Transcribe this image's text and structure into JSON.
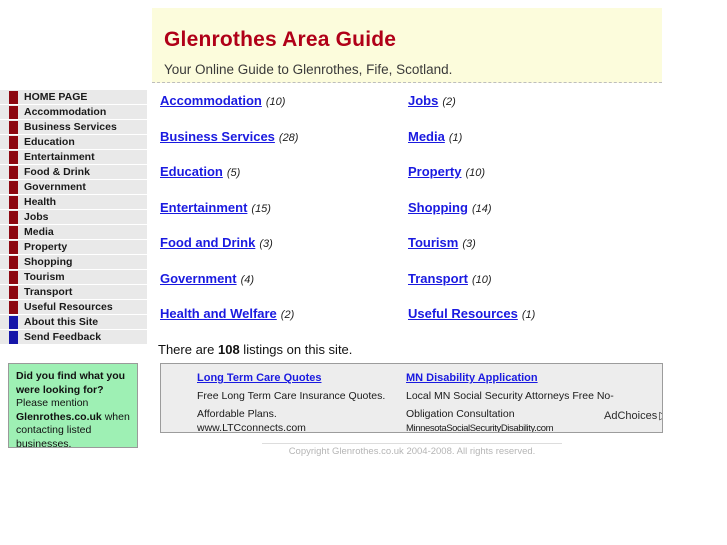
{
  "banner": {
    "title": "Glenrothes Area Guide",
    "tagline": "Your Online Guide to Glenrothes, Fife, Scotland."
  },
  "sidebar": {
    "items": [
      {
        "label": "HOME PAGE",
        "bullet_color": "#8c0711"
      },
      {
        "label": "Accommodation",
        "bullet_color": "#8c0711"
      },
      {
        "label": "Business Services",
        "bullet_color": "#8c0711"
      },
      {
        "label": "Education",
        "bullet_color": "#8c0711"
      },
      {
        "label": "Entertainment",
        "bullet_color": "#8c0711"
      },
      {
        "label": "Food & Drink",
        "bullet_color": "#8c0711"
      },
      {
        "label": "Government",
        "bullet_color": "#8c0711"
      },
      {
        "label": "Health",
        "bullet_color": "#8c0711"
      },
      {
        "label": "Jobs",
        "bullet_color": "#8c0711"
      },
      {
        "label": "Media",
        "bullet_color": "#8c0711"
      },
      {
        "label": "Property",
        "bullet_color": "#8c0711"
      },
      {
        "label": "Shopping",
        "bullet_color": "#8c0711"
      },
      {
        "label": "Tourism",
        "bullet_color": "#8c0711"
      },
      {
        "label": "Transport",
        "bullet_color": "#8c0711"
      },
      {
        "label": "Useful Resources",
        "bullet_color": "#8c0711"
      },
      {
        "label": "About this Site",
        "bullet_color": "#1515a8"
      },
      {
        "label": "Send Feedback",
        "bullet_color": "#1515a8"
      }
    ]
  },
  "promo": {
    "heading": "Did you find what you were looking for?",
    "text_before": "Please mention ",
    "brand": "Glenrothes.co.uk",
    "text_after": " when contacting listed businesses."
  },
  "categories": {
    "left": [
      {
        "label": "Accommodation",
        "count": "(10)"
      },
      {
        "label": "Business Services",
        "count": "(28)"
      },
      {
        "label": "Education",
        "count": "(5)"
      },
      {
        "label": "Entertainment",
        "count": "(15)"
      },
      {
        "label": "Food and Drink",
        "count": "(3)"
      },
      {
        "label": "Government",
        "count": "(4)"
      },
      {
        "label": "Health and Welfare",
        "count": "(2)"
      }
    ],
    "right": [
      {
        "label": "Jobs",
        "count": "(2)"
      },
      {
        "label": "Media",
        "count": "(1)"
      },
      {
        "label": "Property",
        "count": "(10)"
      },
      {
        "label": "Shopping",
        "count": "(14)"
      },
      {
        "label": "Tourism",
        "count": "(3)"
      },
      {
        "label": "Transport",
        "count": "(10)"
      },
      {
        "label": "Useful Resources",
        "count": "(1)"
      }
    ]
  },
  "listing_total": {
    "prefix": "There are ",
    "count": "108",
    "suffix": " listings on this site."
  },
  "ads": {
    "left": {
      "title": "Long Term Care Quotes",
      "description": "Free Long Term Care Insurance Quotes. Affordable Plans.",
      "url": "www.LTCconnects.com"
    },
    "right": {
      "title": "MN Disability Application",
      "description": "Local MN Social Security Attorneys Free No-Obligation Consultation",
      "url": "MinnesotaSocialSecurityDisability.com"
    },
    "adchoices_label": "AdChoices",
    "adchoices_arrow": "▷"
  },
  "footer": {
    "copyright": "Copyright Glenrothes.co.uk 2004-2008. All rights reserved."
  }
}
